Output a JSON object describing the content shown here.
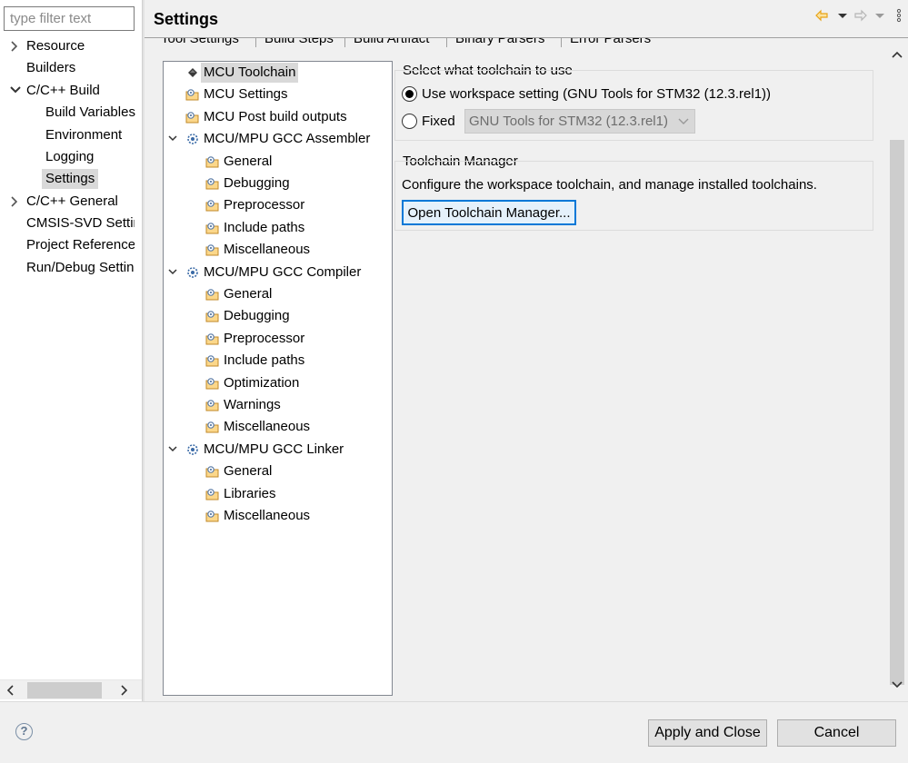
{
  "filter": {
    "placeholder": "type filter text",
    "value": ""
  },
  "nav": {
    "items": [
      {
        "label": "Resource",
        "expandable": true,
        "expanded": false
      },
      {
        "label": "Builders"
      },
      {
        "label": "C/C++ Build",
        "expandable": true,
        "expanded": true
      },
      {
        "label": "Build Variables"
      },
      {
        "label": "Environment"
      },
      {
        "label": "Logging"
      },
      {
        "label": "Settings",
        "selected": true
      },
      {
        "label": "C/C++ General",
        "expandable": true,
        "expanded": false
      },
      {
        "label": "CMSIS-SVD Settings"
      },
      {
        "label": "Project References"
      },
      {
        "label": "Run/Debug Settings"
      }
    ]
  },
  "header": {
    "title": "Settings"
  },
  "tabs": [
    {
      "label": "Tool Settings"
    },
    {
      "label": "Build Steps"
    },
    {
      "label": "Build Artifact"
    },
    {
      "label": "Binary Parsers"
    },
    {
      "label": "Error Parsers"
    }
  ],
  "tree": {
    "items": [
      {
        "label": "MCU Toolchain",
        "icon": "chip-icon",
        "selected": true
      },
      {
        "label": "MCU Settings",
        "icon": "settings-folder-icon"
      },
      {
        "label": "MCU Post build outputs",
        "icon": "settings-folder-icon"
      },
      {
        "label": "MCU/MPU GCC Assembler",
        "icon": "tool-gear-icon",
        "expanded": true
      },
      {
        "label": "General",
        "icon": "settings-folder-icon"
      },
      {
        "label": "Debugging",
        "icon": "settings-folder-icon"
      },
      {
        "label": "Preprocessor",
        "icon": "settings-folder-icon"
      },
      {
        "label": "Include paths",
        "icon": "settings-folder-icon"
      },
      {
        "label": "Miscellaneous",
        "icon": "settings-folder-icon"
      },
      {
        "label": "MCU/MPU GCC Compiler",
        "icon": "tool-gear-icon",
        "expanded": true
      },
      {
        "label": "General",
        "icon": "settings-folder-icon"
      },
      {
        "label": "Debugging",
        "icon": "settings-folder-icon"
      },
      {
        "label": "Preprocessor",
        "icon": "settings-folder-icon"
      },
      {
        "label": "Include paths",
        "icon": "settings-folder-icon"
      },
      {
        "label": "Optimization",
        "icon": "settings-folder-icon"
      },
      {
        "label": "Warnings",
        "icon": "settings-folder-icon"
      },
      {
        "label": "Miscellaneous",
        "icon": "settings-folder-icon"
      },
      {
        "label": "MCU/MPU GCC Linker",
        "icon": "tool-gear-icon",
        "expanded": true
      },
      {
        "label": "General",
        "icon": "settings-folder-icon"
      },
      {
        "label": "Libraries",
        "icon": "settings-folder-icon"
      },
      {
        "label": "Miscellaneous",
        "icon": "settings-folder-icon"
      }
    ]
  },
  "toolchain": {
    "group_title": "Select what toolchain to use",
    "workspace_option": "Use workspace setting (GNU Tools for STM32 (12.3.rel1))",
    "workspace_selected": true,
    "fixed_option": "Fixed",
    "fixed_value": "GNU Tools for STM32 (12.3.rel1)"
  },
  "manager": {
    "group_title": "Toolchain Manager",
    "description": "Configure the workspace toolchain, and manage installed toolchains.",
    "button": "Open Toolchain Manager..."
  },
  "footer": {
    "apply_close": "Apply and Close",
    "cancel": "Cancel",
    "help_glyph": "?"
  },
  "colors": {
    "accent": "#0078d7",
    "selection": "#d9d9d9",
    "back_arrow": "#e8a317"
  }
}
